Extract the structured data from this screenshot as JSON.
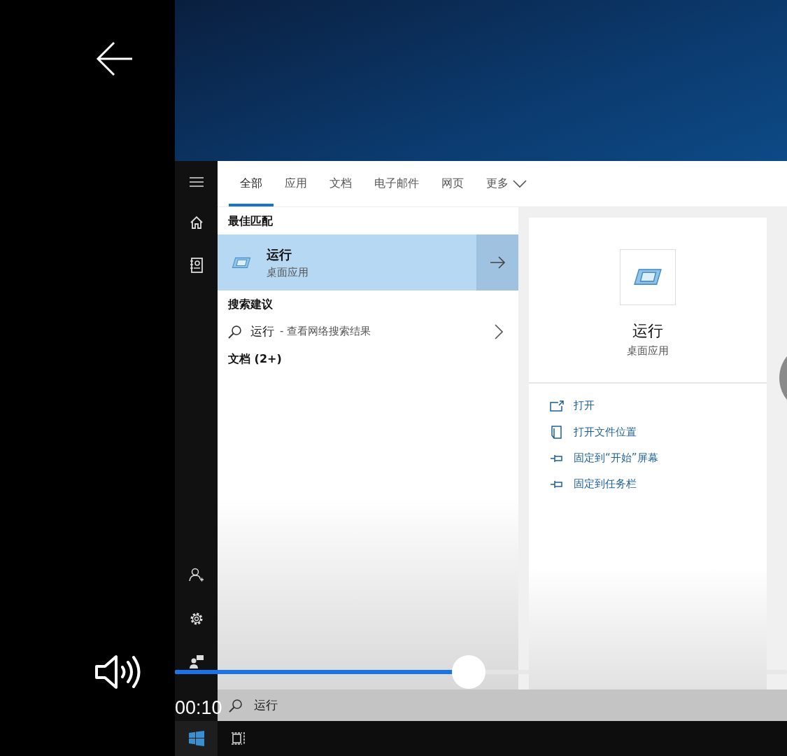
{
  "tabs": [
    {
      "label": "全部",
      "selected": true
    },
    {
      "label": "应用",
      "selected": false
    },
    {
      "label": "文档",
      "selected": false
    },
    {
      "label": "电子邮件",
      "selected": false
    },
    {
      "label": "网页",
      "selected": false
    },
    {
      "label": "更多",
      "selected": false,
      "kind": "dropdown"
    }
  ],
  "best_match": {
    "heading": "最佳匹配",
    "title": "运行",
    "subtitle": "桌面应用",
    "selected": true
  },
  "suggestions": {
    "heading": "搜索建议",
    "items": [
      {
        "query": "运行",
        "hint": "- 查看网络搜索结果"
      }
    ]
  },
  "documents": {
    "heading": "文档 (2+)"
  },
  "preview": {
    "title": "运行",
    "subtitle": "桌面应用",
    "actions": [
      {
        "kind": "open",
        "label": "打开"
      },
      {
        "kind": "folder",
        "label": "打开文件位置"
      },
      {
        "kind": "pin",
        "label": "固定到“开始”屏幕"
      },
      {
        "kind": "pin",
        "label": "固定到任务栏"
      }
    ]
  },
  "search": {
    "value": "运行"
  },
  "player": {
    "time": "00:10",
    "progress": {
      "level": 0.48
    }
  }
}
